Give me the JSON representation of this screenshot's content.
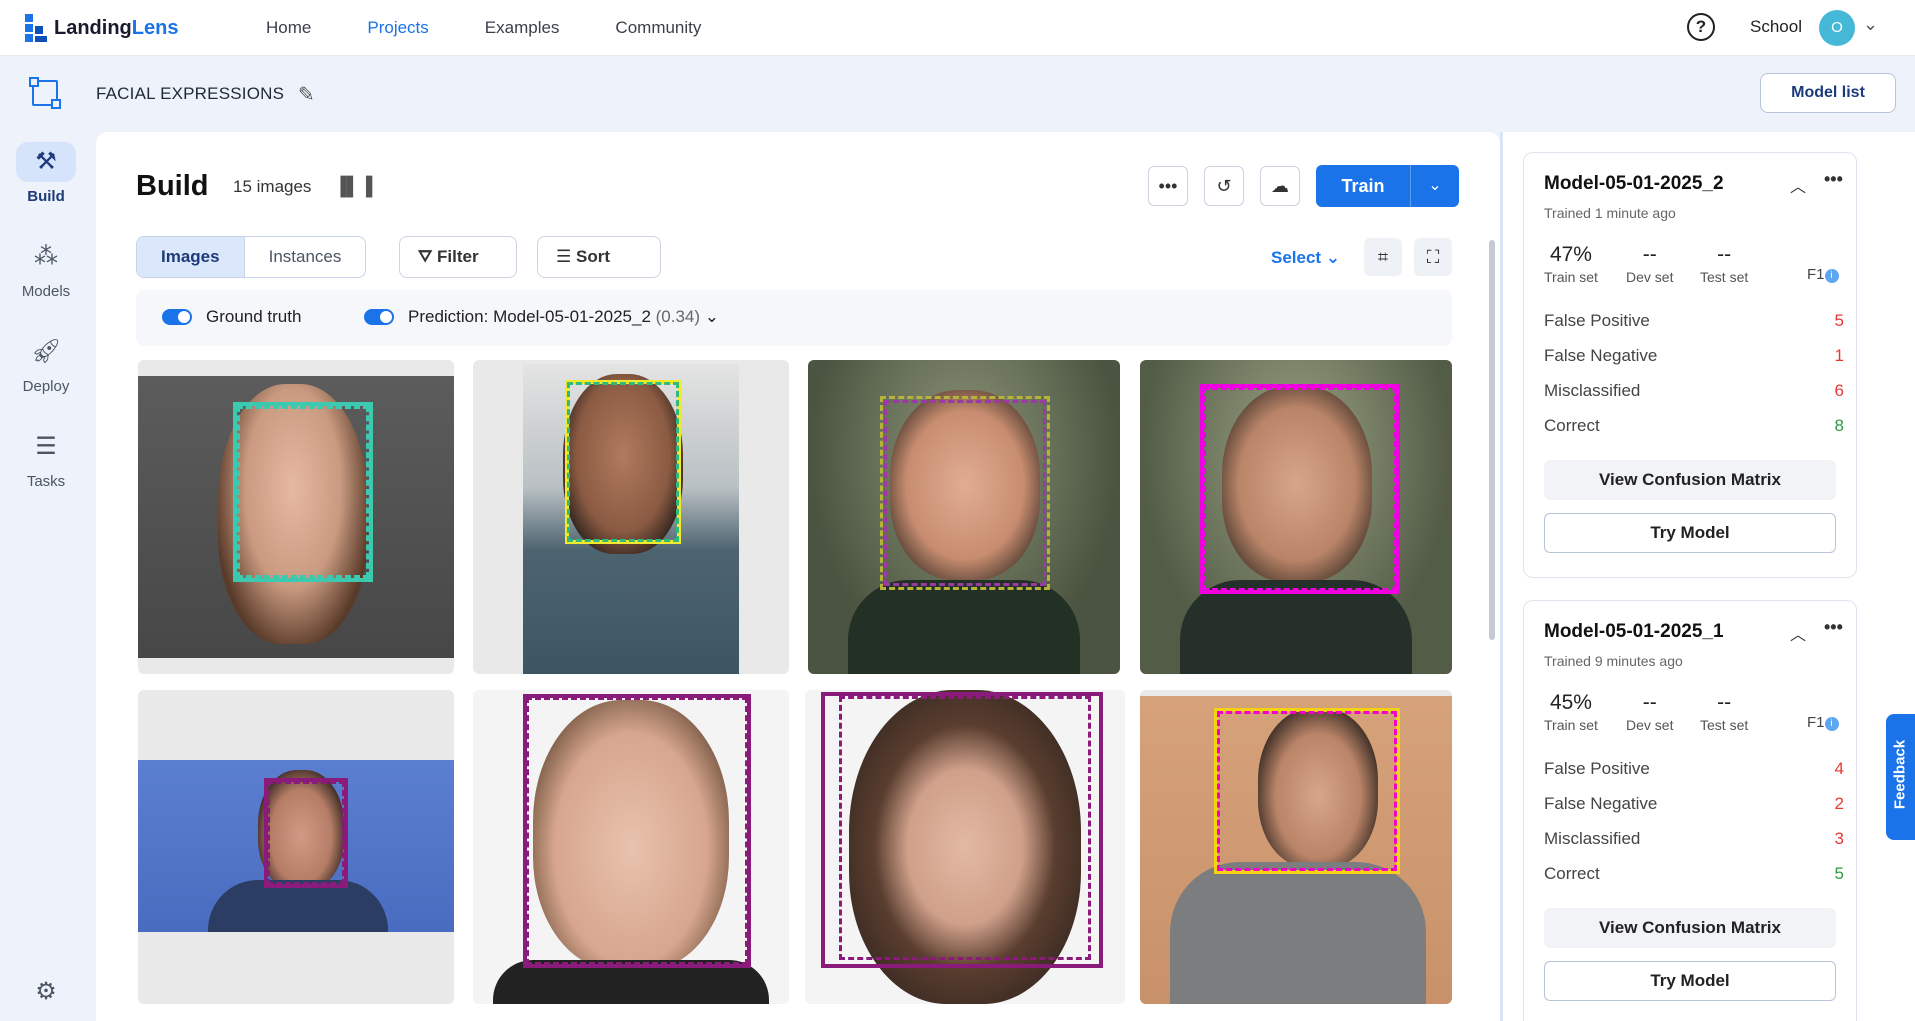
{
  "app": {
    "logo_main": "Landing",
    "logo_accent": "Lens",
    "colors": {
      "accent": "#1a73e8",
      "brand_dark": "#1d3b7a",
      "positive": "#2e9a3e",
      "negative": "#e53935"
    }
  },
  "nav": {
    "links": [
      "Home",
      "Projects",
      "Examples",
      "Community"
    ],
    "active": "Projects",
    "org": "School",
    "avatar_initial": "O"
  },
  "project": {
    "title": "FACIAL EXPRESSIONS",
    "model_list_label": "Model list"
  },
  "sidebar": {
    "items": [
      {
        "label": "Build",
        "icon": "wrench-hammer-icon"
      },
      {
        "label": "Models",
        "icon": "network-icon"
      },
      {
        "label": "Deploy",
        "icon": "rocket-icon"
      },
      {
        "label": "Tasks",
        "icon": "checklist-icon"
      }
    ],
    "active": "Build",
    "settings_icon": "gear-icon"
  },
  "build": {
    "title": "Build",
    "image_count": "15 images",
    "train_label": "Train",
    "view_tabs": [
      "Images",
      "Instances"
    ],
    "active_tab": "Images",
    "filter_label": "Filter",
    "sort_label": "Sort",
    "select_label": "Select",
    "ground_truth_label": "Ground truth",
    "prediction_label": "Prediction:",
    "prediction_model": "Model-05-01-2025_2",
    "prediction_threshold": "(0.34)"
  },
  "images": [
    {
      "name": "woman-shouting",
      "gt_color": "#3cc9b0",
      "pred_color": "#3cc9b0"
    },
    {
      "name": "man-screaming",
      "gt_color": "#f1e92b",
      "pred_color": "#2fb97a"
    },
    {
      "name": "man-eyes-rolled",
      "gt_color": "#b6b33a",
      "pred_color": "#9b3aa6"
    },
    {
      "name": "man-frowning",
      "gt_color": "#f000e0",
      "pred_color": "#f000e0"
    },
    {
      "name": "woman-crying",
      "gt_color": "#8a1b7a",
      "pred_color": "#8a1b7a"
    },
    {
      "name": "man-pouting",
      "gt_color": "#8a1b7a",
      "pred_color": "#8a1b7a"
    },
    {
      "name": "woman-sad",
      "gt_color": "#8a1b7a",
      "pred_color": "#8a1b7a"
    },
    {
      "name": "man-smirking",
      "gt_color": "#f5d312",
      "pred_color": "#f000c8"
    }
  ],
  "models": [
    {
      "name": "Model-05-01-2025_2",
      "trained": "Trained 1 minute ago",
      "train_set": "47%",
      "dev_set": "--",
      "test_set": "--",
      "train_set_label": "Train set",
      "dev_set_label": "Dev set",
      "test_set_label": "Test set",
      "metric": "F1",
      "false_positive": "5",
      "false_negative": "1",
      "misclassified": "6",
      "correct": "8"
    },
    {
      "name": "Model-05-01-2025_1",
      "trained": "Trained 9 minutes ago",
      "train_set": "45%",
      "dev_set": "--",
      "test_set": "--",
      "train_set_label": "Train set",
      "dev_set_label": "Dev set",
      "test_set_label": "Test set",
      "metric": "F1",
      "false_positive": "4",
      "false_negative": "2",
      "misclassified": "3",
      "correct": "5"
    }
  ],
  "stat_labels": {
    "false_positive": "False Positive",
    "false_negative": "False Negative",
    "misclassified": "Misclassified",
    "correct": "Correct"
  },
  "buttons": {
    "view_confusion": "View Confusion Matrix",
    "try_model": "Try Model"
  },
  "feedback_label": "Feedback"
}
